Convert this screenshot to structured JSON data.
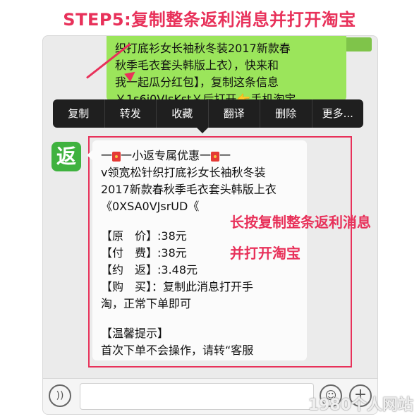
{
  "header": {
    "title": "STEP5:复制整条返利消息并打开淘宝"
  },
  "chat": {
    "green_bubble_lines": [
      "织打底衫女长袖秋冬装2017新款春",
      "秋季毛衣套头韩版上衣），快来和",
      "我一起瓜分红包】，复制这条信息",
      "￥1s6i0VJsKst￥后打开👉手机淘宝"
    ],
    "context_menu": [
      "复制",
      "转发",
      "收藏",
      "翻译",
      "删除",
      "更多..."
    ],
    "avatar_label": "返",
    "white_bubble": {
      "header_left": "一",
      "header_mid": "一小返专属优惠一",
      "header_right": "一",
      "lines": [
        "v领宽松针织打底衫女长袖秋冬装",
        "2017新款春秋季毛衣套头韩版上衣",
        "《0XSA0VJsrUD《"
      ],
      "price_lines": [
        "【原　价】:38元",
        "【付　费】:38元",
        "【约　返】:3.48元",
        "【购　买】：复制此消息打开手",
        "淘，正常下单即可"
      ],
      "tip_lines": [
        "【温馨提示】",
        "首次下单不会操作，请转“客服"
      ]
    }
  },
  "annotations": {
    "line1": "长按复制整条返利消息",
    "line2": "并打开淘宝"
  },
  "input_bar": {
    "voice_icon": "voice-icon",
    "emoji_icon": "emoji-icon",
    "plus_icon": "plus-icon"
  },
  "watermark": "1980个人网站",
  "colors": {
    "accent_red": "#e8315a",
    "bubble_green": "#9be55b",
    "menu_bg": "#1f1f1f"
  }
}
